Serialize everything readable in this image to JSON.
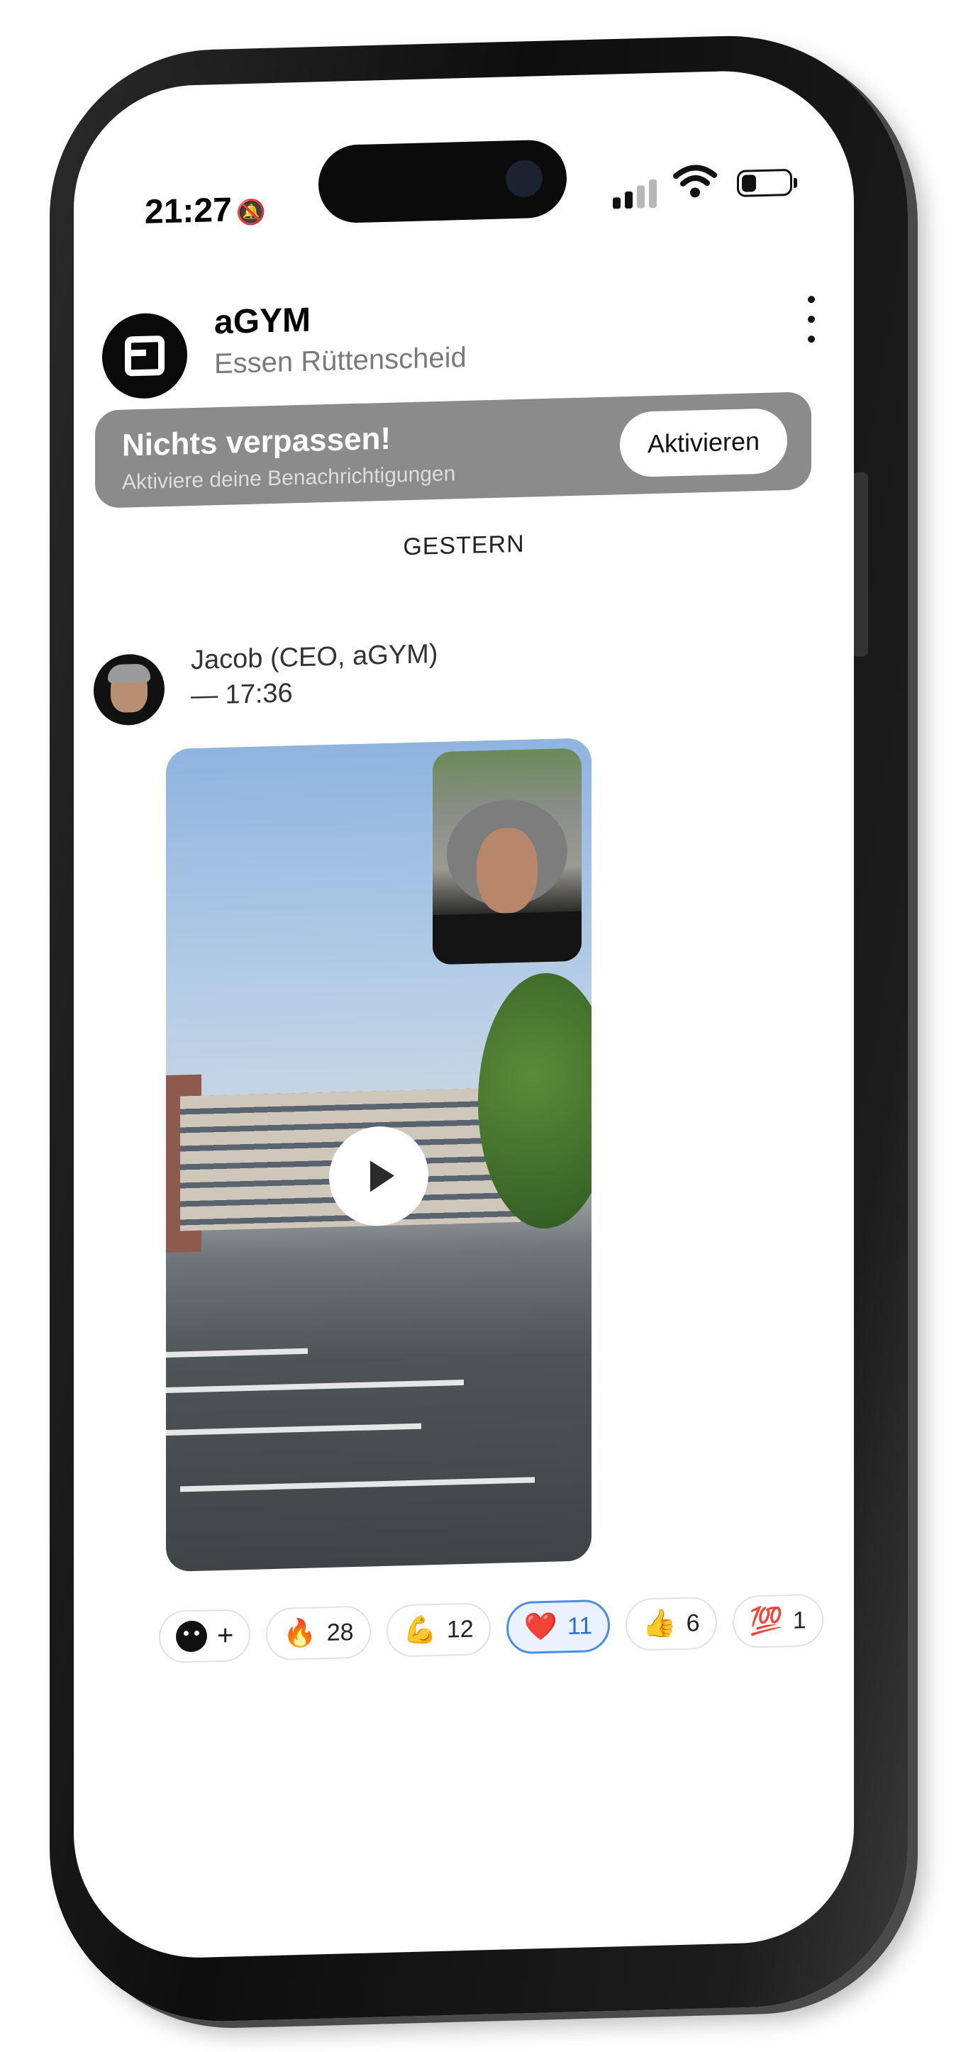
{
  "status_bar": {
    "time": "21:27",
    "silent_icon": "bell-slash-icon",
    "signal_icon": "cellular-signal-icon",
    "wifi_icon": "wifi-icon",
    "battery_icon": "battery-icon",
    "battery_level": 0.3
  },
  "header": {
    "logo_icon": "agym-logo-icon",
    "title": "aGYM",
    "subtitle": "Essen Rüttenscheid",
    "menu_icon": "more-vertical-icon"
  },
  "notification_banner": {
    "title": "Nichts verpassen!",
    "subtitle": "Aktiviere deine Benachrichtigungen",
    "button_label": "Aktivieren"
  },
  "feed": {
    "day_divider": "GESTERN",
    "post": {
      "author": "Jacob (CEO, aGYM)",
      "time": "— 17:36",
      "video": {
        "play_icon": "play-icon"
      },
      "add_reaction_label": "+",
      "reactions": [
        {
          "emoji": "🔥",
          "count": "28",
          "active": false
        },
        {
          "emoji": "💪",
          "count": "12",
          "active": false
        },
        {
          "emoji": "❤️",
          "count": "11",
          "active": true
        },
        {
          "emoji": "👍",
          "count": "6",
          "active": false
        },
        {
          "emoji": "💯",
          "count": "1",
          "active": false
        }
      ]
    }
  },
  "colors": {
    "banner_bg": "#8b8b8b",
    "active_reaction_border": "#4a8ee8",
    "active_reaction_bg": "#eaf2ff"
  }
}
